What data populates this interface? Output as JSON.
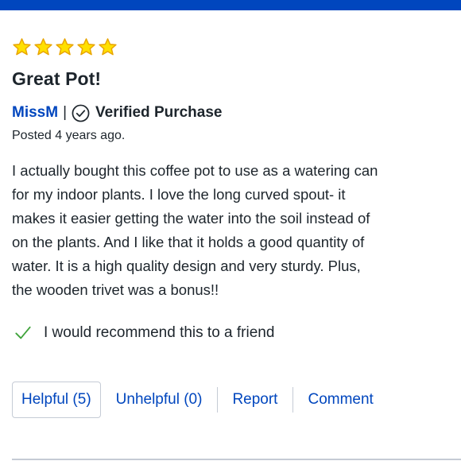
{
  "colors": {
    "brand_bar": "#0046be",
    "link": "#0046be",
    "star": "#ffe000",
    "star_outline": "#e8a400",
    "check": "#3fa33b"
  },
  "rating": {
    "value": 5,
    "max": 5
  },
  "review": {
    "title": "Great Pot!",
    "author": "MissM",
    "separator": "|",
    "verified_label": "Verified Purchase",
    "posted": "Posted 4 years ago.",
    "body_lines": [
      "I actually bought this coffee pot to use as a watering can",
      "for my indoor plants. I love the long curved spout- it",
      "makes it easier getting the water into the soil instead of",
      "on the plants. And I like that it holds a good quantity of",
      "water. It is a high quality design and very sturdy. Plus,",
      "the wooden trivet was a bonus!!"
    ],
    "recommend": "I would recommend this to a friend"
  },
  "actions": {
    "helpful": "Helpful (5)",
    "unhelpful": "Unhelpful (0)",
    "report": "Report",
    "comment": "Comment"
  },
  "icons": {
    "star": "star-icon",
    "verified": "check-circle-icon",
    "recommend": "checkmark-icon"
  }
}
